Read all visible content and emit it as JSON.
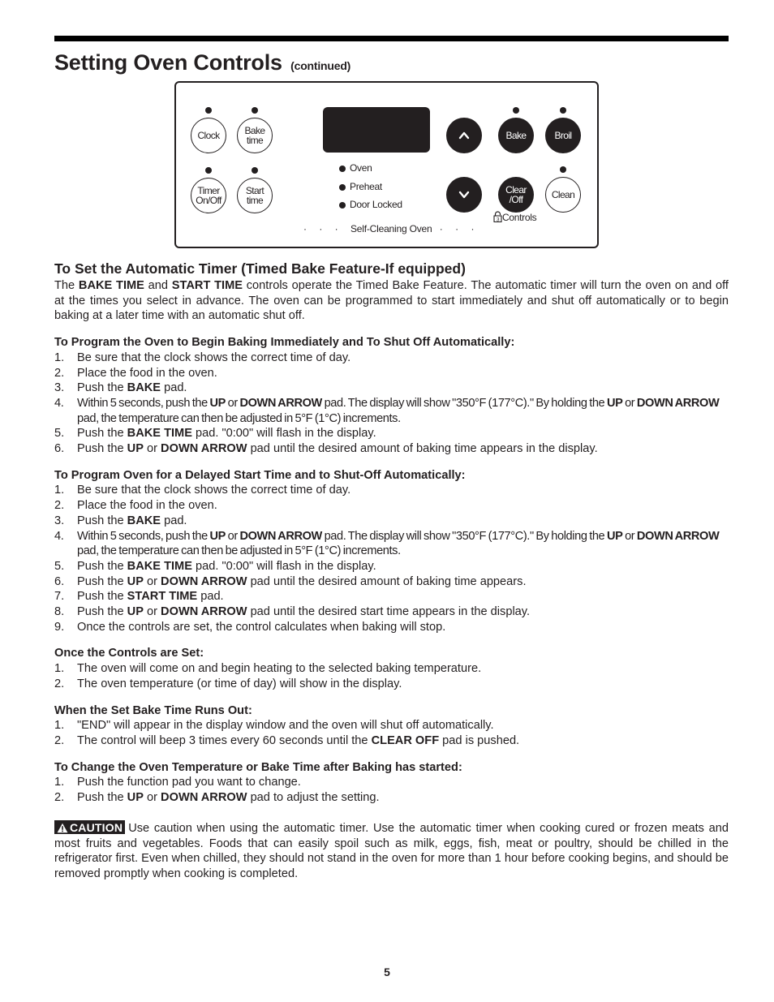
{
  "header": {
    "title": "Setting Oven Controls",
    "title_suffix": "(continued)"
  },
  "panel": {
    "buttons": {
      "clock": "Clock",
      "bake_time_1": "Bake",
      "bake_time_2": "time",
      "timer_1": "Timer",
      "timer_2": "On/Off",
      "start_time_1": "Start",
      "start_time_2": "time",
      "bake": "Bake",
      "broil": "Broil",
      "clear_1": "Clear",
      "clear_2": "/Off",
      "clean": "Clean",
      "up_arrow_icon": "chevron-up-icon",
      "down_arrow_icon": "chevron-down-icon"
    },
    "indicators": [
      "Oven",
      "Preheat",
      "Door Locked"
    ],
    "lock_controls_label": "Controls",
    "lock_icon_digit": "3",
    "self_cleaning_label": "Self-Cleaning Oven"
  },
  "timer_section": {
    "heading": "To Set the Automatic Timer (Timed Bake Feature-If equipped)",
    "intro_parts": [
      "The ",
      "BAKE TIME",
      " and ",
      "START TIME",
      " controls operate the Timed Bake Feature. The automatic timer will turn the oven on and off at the times you select in advance. The oven can be programmed to start immediately and shut off automatically or to begin baking at a later time with an automatic shut off."
    ]
  },
  "immediate": {
    "heading": "To Program the Oven to Begin Baking Immediately and To Shut Off Automatically:",
    "steps": [
      {
        "num": "1.",
        "parts": [
          "Be sure that the clock shows the correct time of day."
        ]
      },
      {
        "num": "2.",
        "parts": [
          "Place the food in the oven."
        ]
      },
      {
        "num": "3.",
        "parts": [
          "Push the ",
          "BAKE",
          " pad."
        ]
      },
      {
        "num": "4.",
        "parts": [
          "Within 5 seconds, push the ",
          "UP",
          " or ",
          "DOWN ARROW",
          " pad. The display will show \"350°F (177°C).\" By holding the ",
          "UP",
          " or ",
          "DOWN ARROW",
          " pad, the temperature can then be adjusted in 5°F (1°C) increments."
        ]
      },
      {
        "num": "5.",
        "parts": [
          "Push the ",
          "BAKE TIME",
          " pad. \"0:00\" will flash in the display."
        ]
      },
      {
        "num": "6.",
        "parts": [
          "Push the ",
          "UP",
          " or ",
          "DOWN ARROW",
          " pad until the desired amount of baking time appears in the display."
        ]
      }
    ]
  },
  "delayed": {
    "heading": "To Program Oven for a Delayed Start Time and to Shut-Off Automatically:",
    "steps": [
      {
        "num": "1.",
        "parts": [
          "Be sure that the clock shows the correct time of day."
        ]
      },
      {
        "num": "2.",
        "parts": [
          "Place the food in the oven."
        ]
      },
      {
        "num": "3.",
        "parts": [
          "Push the ",
          "BAKE",
          " pad."
        ]
      },
      {
        "num": "4.",
        "parts": [
          "Within 5 seconds, push the ",
          "UP",
          " or ",
          "DOWN ARROW",
          " pad. The display will show \"350°F (177°C).\" By holding the ",
          "UP",
          " or ",
          "DOWN ARROW",
          " pad, the temperature can then be adjusted in 5°F (1°C) increments."
        ]
      },
      {
        "num": "5.",
        "parts": [
          "Push the ",
          "BAKE TIME",
          " pad. \"0:00\" will flash in the display."
        ]
      },
      {
        "num": "6.",
        "parts": [
          "Push the ",
          "UP",
          " or ",
          "DOWN ARROW",
          " pad until the desired amount of baking time appears."
        ]
      },
      {
        "num": "7.",
        "parts": [
          "Push the ",
          "START TIME",
          " pad."
        ]
      },
      {
        "num": "8.",
        "parts": [
          "Push the ",
          "UP",
          " or ",
          "DOWN ARROW",
          " pad until the desired start time appears in the display."
        ]
      },
      {
        "num": "9.",
        "parts": [
          "Once the controls are set, the control calculates when baking will stop."
        ]
      }
    ]
  },
  "once_set": {
    "heading": "Once the Controls are Set:",
    "steps": [
      {
        "num": "1.",
        "parts": [
          "The oven will come on and begin heating to the selected baking temperature."
        ]
      },
      {
        "num": "2.",
        "parts": [
          "The oven temperature (or time of day) will show in the display."
        ]
      }
    ]
  },
  "runs_out": {
    "heading": "When the Set Bake Time Runs Out:",
    "steps": [
      {
        "num": "1.",
        "parts": [
          "\"END\" will appear in the display window and the oven will shut off automatically."
        ]
      },
      {
        "num": "2.",
        "parts": [
          "The control will beep 3 times every 60 seconds until the ",
          "CLEAR OFF",
          " pad is pushed."
        ]
      }
    ]
  },
  "change": {
    "heading": "To Change the Oven Temperature or Bake Time after Baking has started:",
    "steps": [
      {
        "num": "1.",
        "parts": [
          "Push the function pad you want to change."
        ]
      },
      {
        "num": "2.",
        "parts": [
          "Push the ",
          "UP",
          " or ",
          "DOWN ARROW",
          " pad to adjust the setting."
        ]
      }
    ]
  },
  "caution": {
    "label": "CAUTION",
    "icon": "warning-triangle-icon",
    "text": "Use caution when using the automatic timer. Use the automatic timer when cooking cured or frozen meats and most fruits and vegetables. Foods that can easily spoil such as milk, eggs, fish, meat or poultry, should be chilled in the refrigerator first. Even when chilled, they should not stand in the oven for more than 1 hour before cooking begins, and should be removed promptly when cooking is completed."
  },
  "footer": {
    "page_number": "5"
  }
}
